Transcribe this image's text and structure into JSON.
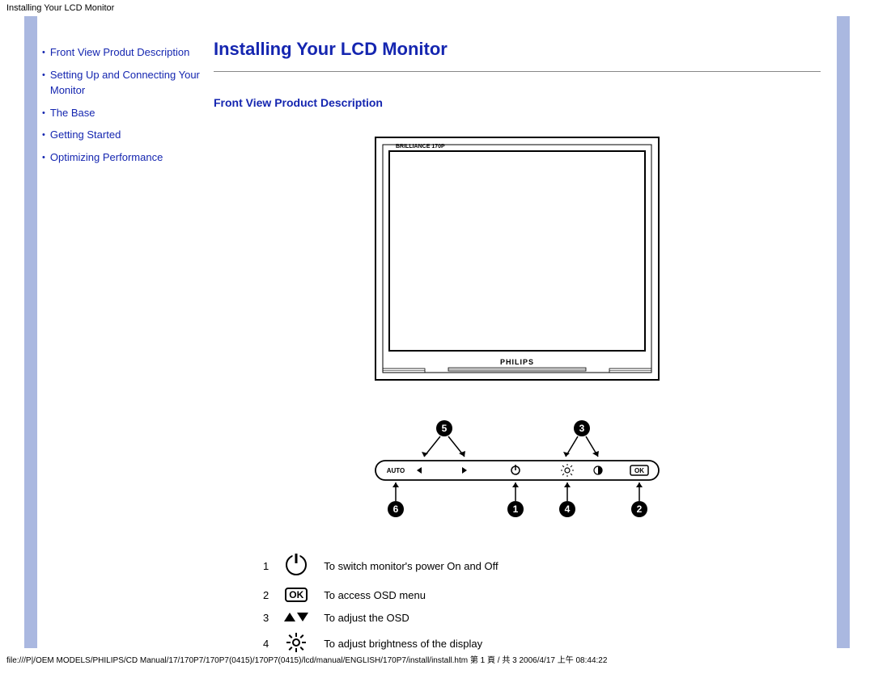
{
  "header": {
    "title": "Installing Your LCD Monitor"
  },
  "nav": {
    "items": [
      {
        "label": "Front View Produt Description"
      },
      {
        "label": "Setting Up and Connecting Your Monitor"
      },
      {
        "label": "The Base"
      },
      {
        "label": "Getting Started"
      },
      {
        "label": "Optimizing Performance"
      }
    ]
  },
  "main": {
    "page_title": "Installing Your LCD Monitor",
    "section_title": "Front View Product Description",
    "monitor": {
      "badge": "BRILLIANCE 170P",
      "brand": "PHILIPS"
    },
    "panel": {
      "auto_label": "AUTO",
      "callouts": [
        "6",
        "5",
        "1",
        "4",
        "3",
        "2"
      ]
    },
    "legend": [
      {
        "num": "1",
        "icon": "power",
        "desc": "To switch monitor's power On and Off"
      },
      {
        "num": "2",
        "icon": "ok",
        "desc": "To access OSD menu"
      },
      {
        "num": "3",
        "icon": "arrows",
        "desc": "To adjust the OSD"
      },
      {
        "num": "4",
        "icon": "bright",
        "desc": "To adjust brightness of the display"
      }
    ],
    "ok_label": "OK"
  },
  "footer": {
    "path": "file:///P|/OEM MODELS/PHILIPS/CD Manual/17/170P7/170P7(0415)/170P7(0415)/lcd/manual/ENGLISH/170P7/install/install.htm 第 1 頁 / 共 3 2006/4/17 上午 08:44:22"
  }
}
